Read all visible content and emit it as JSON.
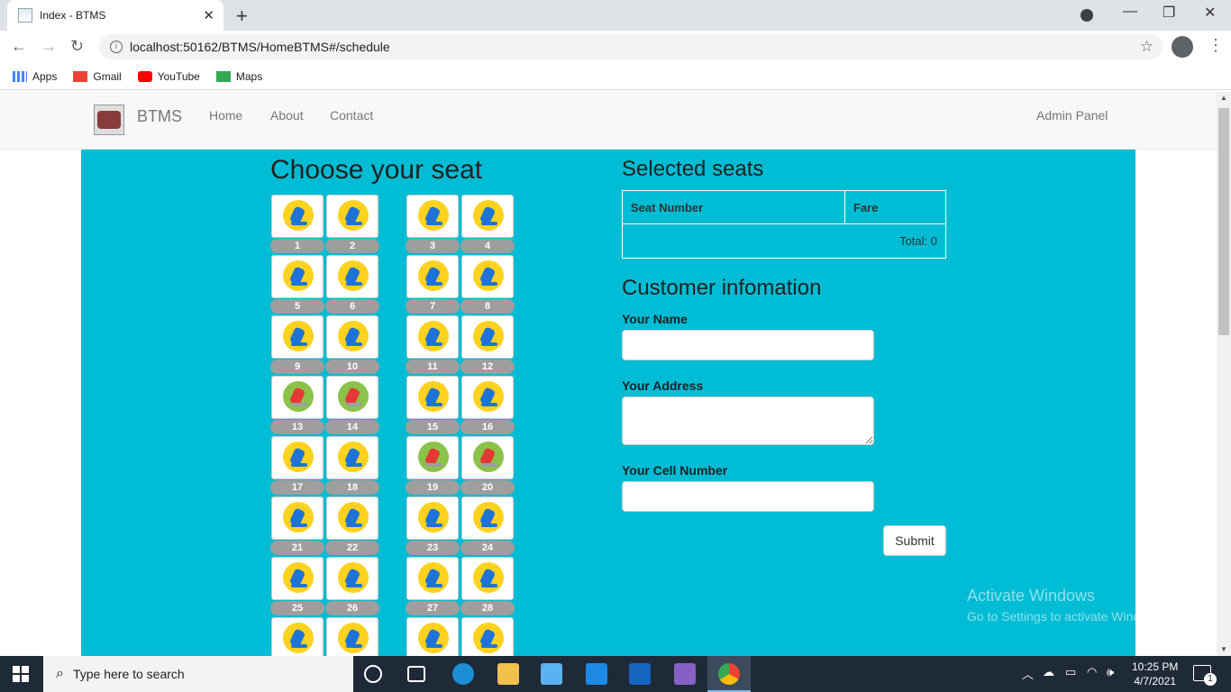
{
  "browser": {
    "tab_title": "Index - BTMS",
    "url": "localhost:50162/BTMS/HomeBTMS#/schedule",
    "bookmarks": [
      "Apps",
      "Gmail",
      "YouTube",
      "Maps"
    ]
  },
  "nav": {
    "brand": "BTMS",
    "links": [
      "Home",
      "About",
      "Contact"
    ],
    "admin": "Admin Panel"
  },
  "seats": {
    "title": "Choose your seat",
    "booked_color": "#8bc34a",
    "available_color": "#ffd21f",
    "list": [
      {
        "number": "1",
        "status": "available"
      },
      {
        "number": "2",
        "status": "available"
      },
      {
        "number": "3",
        "status": "available"
      },
      {
        "number": "4",
        "status": "available"
      },
      {
        "number": "5",
        "status": "available"
      },
      {
        "number": "6",
        "status": "available"
      },
      {
        "number": "7",
        "status": "available"
      },
      {
        "number": "8",
        "status": "available"
      },
      {
        "number": "9",
        "status": "available"
      },
      {
        "number": "10",
        "status": "available"
      },
      {
        "number": "11",
        "status": "available"
      },
      {
        "number": "12",
        "status": "available"
      },
      {
        "number": "13",
        "status": "booked"
      },
      {
        "number": "14",
        "status": "booked"
      },
      {
        "number": "15",
        "status": "available"
      },
      {
        "number": "16",
        "status": "available"
      },
      {
        "number": "17",
        "status": "available"
      },
      {
        "number": "18",
        "status": "available"
      },
      {
        "number": "19",
        "status": "booked"
      },
      {
        "number": "20",
        "status": "booked"
      },
      {
        "number": "21",
        "status": "available"
      },
      {
        "number": "22",
        "status": "available"
      },
      {
        "number": "23",
        "status": "available"
      },
      {
        "number": "24",
        "status": "available"
      },
      {
        "number": "25",
        "status": "available"
      },
      {
        "number": "26",
        "status": "available"
      },
      {
        "number": "27",
        "status": "available"
      },
      {
        "number": "28",
        "status": "available"
      },
      {
        "number": "",
        "status": "available"
      },
      {
        "number": "",
        "status": "available"
      },
      {
        "number": "",
        "status": "available"
      },
      {
        "number": "",
        "status": "available"
      }
    ]
  },
  "selected": {
    "title": "Selected seats",
    "col_seat": "Seat Number",
    "col_fare": "Fare",
    "total": "Total: 0"
  },
  "customer": {
    "title": "Customer infomation",
    "name_label": "Your Name",
    "address_label": "Your Address",
    "cell_label": "Your Cell Number",
    "name_value": "",
    "address_value": "",
    "cell_value": "",
    "submit": "Submit"
  },
  "watermark": {
    "line1": "Activate Windows",
    "line2": "Go to Settings to activate Windows."
  },
  "taskbar": {
    "search_placeholder": "Type here to search",
    "time": "10:25 PM",
    "date": "4/7/2021",
    "notification_count": "1"
  }
}
